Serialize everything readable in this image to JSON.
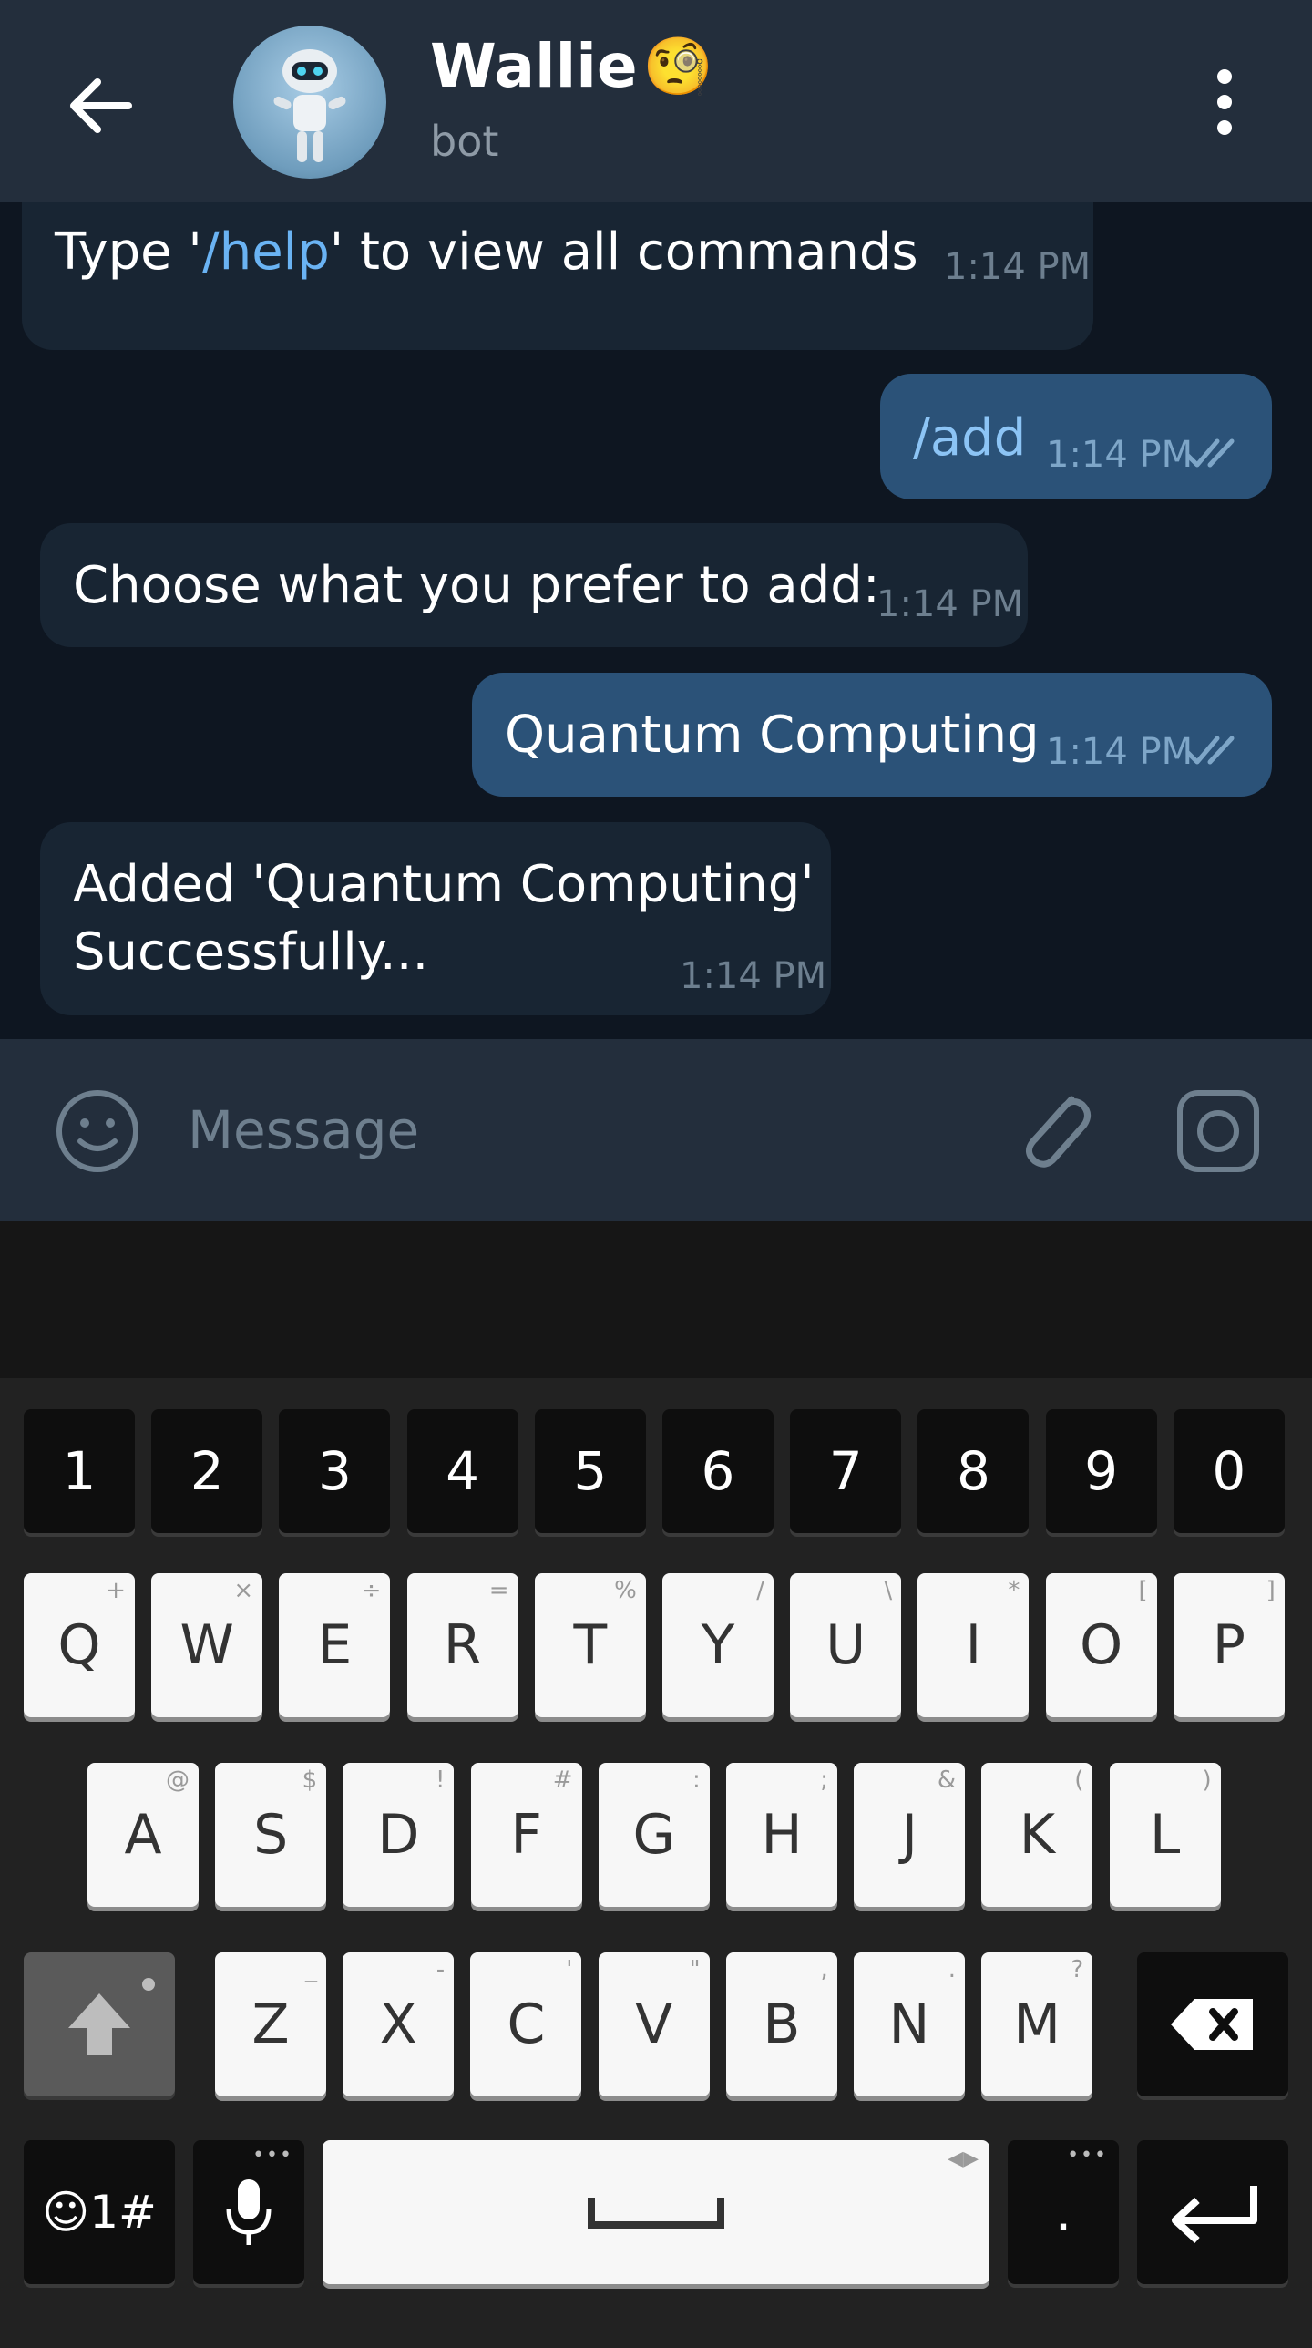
{
  "header": {
    "title": "Wallie",
    "title_emoji": "🧐",
    "subtitle": "bot",
    "back_icon": "arrow-left-icon",
    "menu_icon": "more-vertical-icon"
  },
  "messages": [
    {
      "direction": "in",
      "text_before": "Type '",
      "link": "/help",
      "text_after": "' to view all commands",
      "time": "1:14 PM"
    },
    {
      "direction": "out",
      "text": "/add",
      "time": "1:14 PM",
      "status": "read"
    },
    {
      "direction": "in",
      "text": "Choose what you prefer to add:",
      "time": "1:14 PM"
    },
    {
      "direction": "out",
      "text": "Quantum Computing",
      "time": "1:14 PM",
      "status": "read"
    },
    {
      "direction": "in",
      "line1": "Added 'Quantum Computing'",
      "line2": "Successfully...",
      "time": "1:14 PM"
    }
  ],
  "composer": {
    "placeholder": "Message",
    "value": ""
  },
  "keyboard": {
    "number_row": [
      "1",
      "2",
      "3",
      "4",
      "5",
      "6",
      "7",
      "8",
      "9",
      "0"
    ],
    "row1": [
      {
        "key": "Q",
        "hint": "+"
      },
      {
        "key": "W",
        "hint": "×"
      },
      {
        "key": "E",
        "hint": "÷"
      },
      {
        "key": "R",
        "hint": "="
      },
      {
        "key": "T",
        "hint": "%"
      },
      {
        "key": "Y",
        "hint": "/"
      },
      {
        "key": "U",
        "hint": "\\"
      },
      {
        "key": "I",
        "hint": "*"
      },
      {
        "key": "O",
        "hint": "["
      },
      {
        "key": "P",
        "hint": "]"
      }
    ],
    "row2": [
      {
        "key": "A",
        "hint": "@"
      },
      {
        "key": "S",
        "hint": "$"
      },
      {
        "key": "D",
        "hint": "!"
      },
      {
        "key": "F",
        "hint": "#"
      },
      {
        "key": "G",
        "hint": ":"
      },
      {
        "key": "H",
        "hint": ";"
      },
      {
        "key": "J",
        "hint": "&"
      },
      {
        "key": "K",
        "hint": "("
      },
      {
        "key": "L",
        "hint": ")"
      }
    ],
    "row3": [
      {
        "key": "Z",
        "hint": "_"
      },
      {
        "key": "X",
        "hint": "-"
      },
      {
        "key": "C",
        "hint": "'"
      },
      {
        "key": "V",
        "hint": "\""
      },
      {
        "key": "B",
        "hint": ","
      },
      {
        "key": "N",
        "hint": "."
      },
      {
        "key": "M",
        "hint": "?"
      }
    ],
    "symbols_label": "☺1#",
    "period_label": ".",
    "dots": "•••"
  }
}
